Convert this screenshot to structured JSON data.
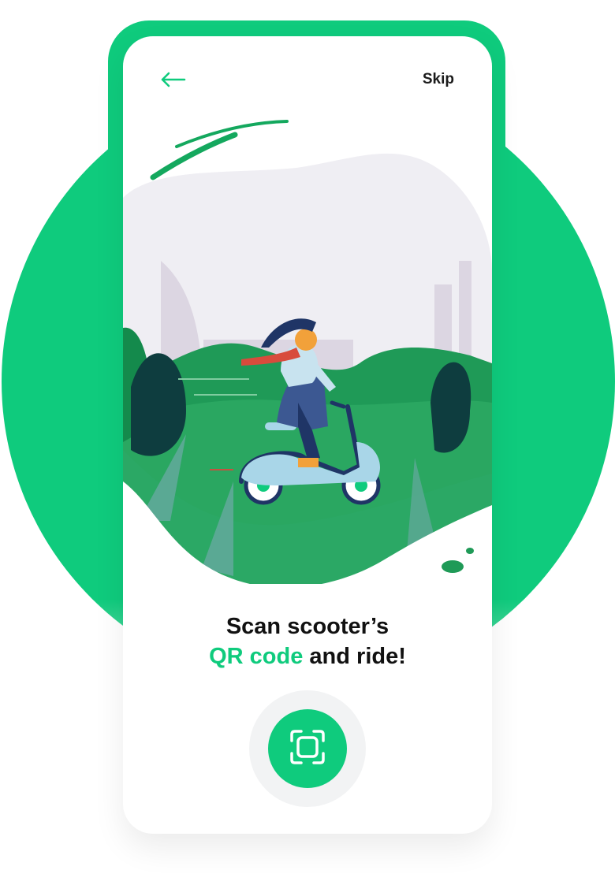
{
  "header": {
    "back_icon": "arrow-left-icon",
    "skip_label": "Skip"
  },
  "illustration": {
    "subject": "woman-riding-scooter-illustration"
  },
  "headline": {
    "line1": "Scan scooter’s",
    "accent": "QR code",
    "rest": " and ride!"
  },
  "scan_button": {
    "icon": "qr-scan-icon"
  },
  "colors": {
    "brand_green": "#0fcb7d",
    "text_dark": "#111111"
  }
}
